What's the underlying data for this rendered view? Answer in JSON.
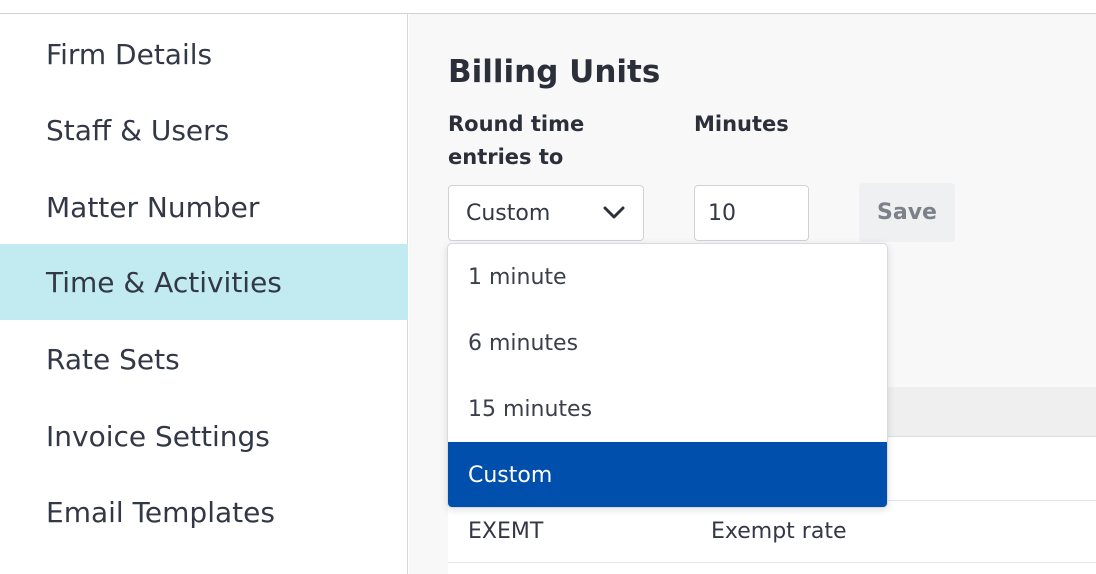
{
  "sidebar": {
    "items": [
      {
        "label": "Firm Details"
      },
      {
        "label": "Staff & Users"
      },
      {
        "label": "Matter Number"
      },
      {
        "label": "Time & Activities",
        "active": true
      },
      {
        "label": "Rate Sets"
      },
      {
        "label": "Invoice Settings"
      },
      {
        "label": "Email Templates"
      }
    ]
  },
  "billing": {
    "title": "Billing Units",
    "round_label_line1": "Round time",
    "round_label_line2": "entries to",
    "minutes_label": "Minutes",
    "selected_value": "Custom",
    "minutes_value": "10",
    "save_label": "Save"
  },
  "dropdown": {
    "options": [
      "1 minute",
      "6 minutes",
      "15 minutes",
      "Custom"
    ],
    "selected_index": 3
  },
  "table": {
    "rows": [
      {
        "code": "EXEMT",
        "description": "Exempt rate"
      }
    ]
  },
  "colors": {
    "active_sidebar_bg": "#c1eaf1",
    "selected_option_bg": "#014fac"
  }
}
